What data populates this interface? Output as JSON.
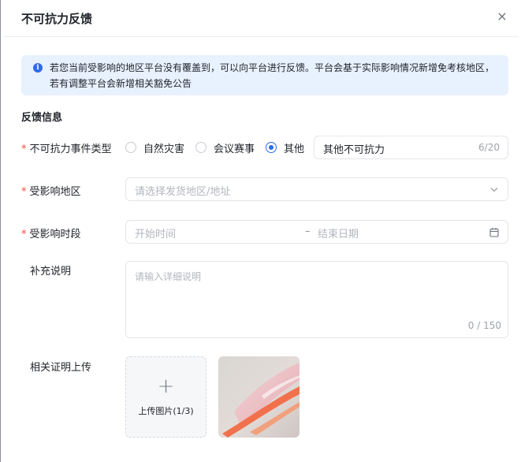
{
  "dialog": {
    "title": "不可抗力反馈",
    "close_glyph": "×"
  },
  "notice": {
    "icon": "info-icon",
    "text": "若您当前受影响的地区平台没有覆盖到，可以向平台进行反馈。平台会基于实际影响情况新增免考核地区，若有调整平台会新增相关豁免公告"
  },
  "section": {
    "title": "反馈信息"
  },
  "form": {
    "required_mark": "*",
    "event_type": {
      "label": "不可抗力事件类型",
      "options": [
        "自然灾害",
        "会议赛事",
        "其他"
      ],
      "selected": "其他",
      "other_value": "其他不可抗力",
      "other_count": "6/20"
    },
    "region": {
      "label": "受影响地区",
      "placeholder": "请选择发货地区/地址",
      "chevron_icon": "chevron-down-icon"
    },
    "period": {
      "label": "受影响时段",
      "start_placeholder": "开始时间",
      "separator": "–",
      "end_placeholder": "结束日期",
      "calendar_icon": "calendar-icon"
    },
    "note": {
      "label": "补充说明",
      "placeholder": "请输入详细说明",
      "count": "0 / 150"
    },
    "upload": {
      "label": "相关证明上传",
      "button_label": "上传图片(1/3)",
      "uploaded_count": 1,
      "max_count": 3
    }
  },
  "colors": {
    "primary": "#2e6be6",
    "required": "#f0483e",
    "notice_bg": "#e8f1fe",
    "border": "#e3e5e9",
    "placeholder": "#b2b6bd"
  }
}
